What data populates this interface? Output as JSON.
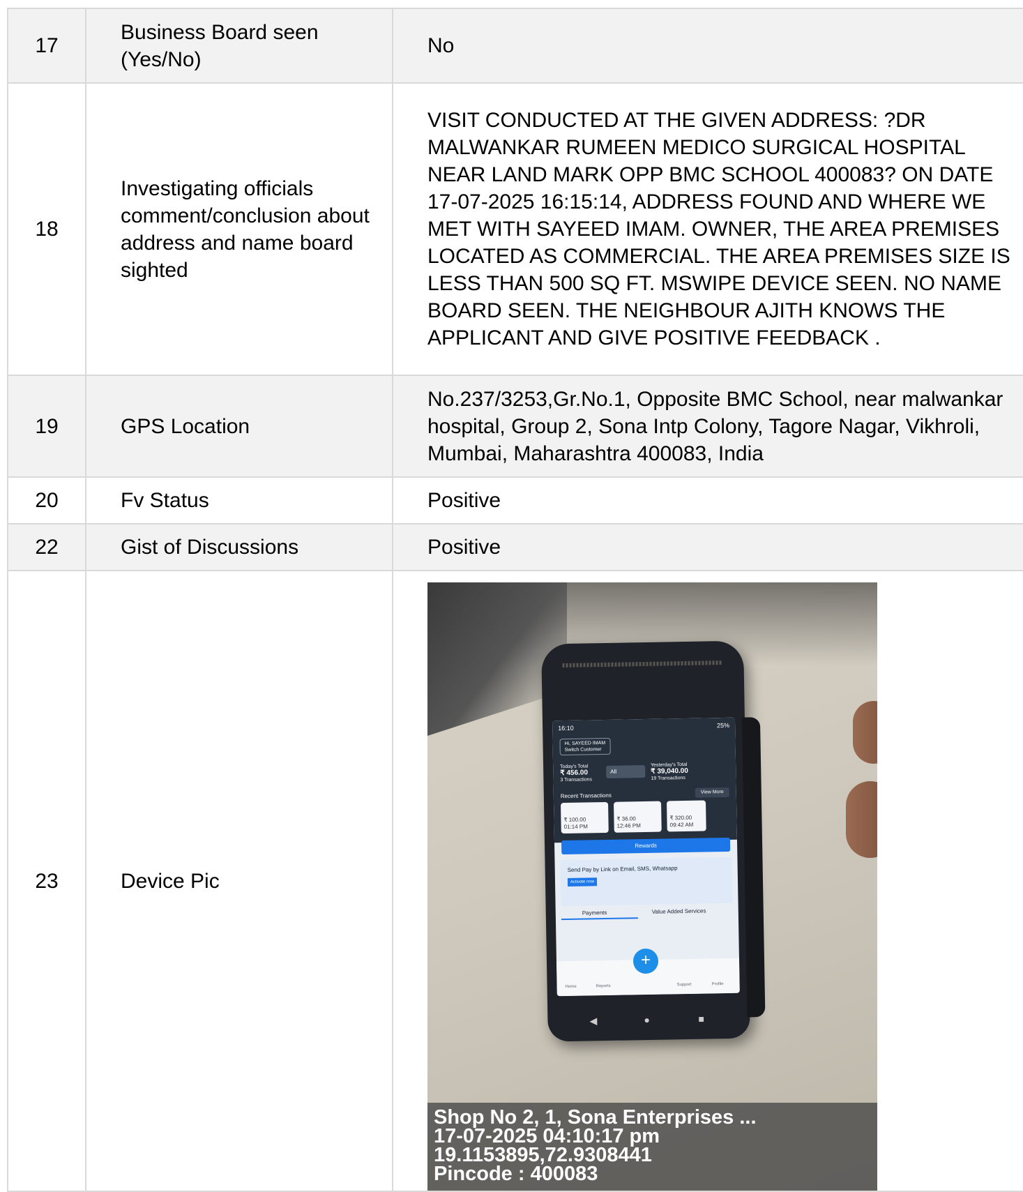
{
  "rows": [
    {
      "no": "17",
      "label": "Business Board seen (Yes/No)",
      "value": "No"
    },
    {
      "no": "18",
      "label": "Investigating officials comment/conclusion about address and name board sighted",
      "value": "VISIT CONDUCTED AT THE GIVEN ADDRESS: ?DR MALWANKAR RUMEEN MEDICO SURGICAL HOSPITAL NEAR LAND MARK OPP BMC SCHOOL 400083? ON DATE 17-07-2025 16:15:14, ADDRESS FOUND AND WHERE WE MET WITH SAYEED IMAM. OWNER, THE AREA PREMISES LOCATED AS COMMERCIAL. THE AREA PREMISES SIZE IS LESS THAN 500 SQ FT. MSWIPE DEVICE SEEN. NO NAME BOARD SEEN. THE NEIGHBOUR AJITH KNOWS THE APPLICANT AND GIVE POSITIVE FEEDBACK ."
    },
    {
      "no": "19",
      "label": "GPS Location",
      "value": "No.237/3253,Gr.No.1, Opposite BMC School, near malwankar hospital, Group 2, Sona Intp Colony, Tagore Nagar, Vikhroli, Mumbai, Maharashtra 400083, India"
    },
    {
      "no": "20",
      "label": "Fv Status",
      "value": "Positive"
    },
    {
      "no": "22",
      "label": "Gist of Discussions",
      "value": "Positive"
    },
    {
      "no": "23",
      "label": "Device Pic",
      "value": ""
    }
  ],
  "photo": {
    "caption": [
      "Shop No 2, 1, Sona Enterprises ...",
      "17-07-2025 04:10:17 pm",
      "19.1153895,72.9308441",
      "Pincode : 400083"
    ],
    "screen": {
      "status_time": "16:10",
      "battery": "25%",
      "greeting": "Hi, SAYEED IMAM",
      "switch": "Switch Customer",
      "today_label": "Today's Total",
      "today_amount": "₹ 456.00",
      "today_count": "3 Transactions",
      "filter": "All",
      "yesterday_label": "Yesterday's Total",
      "yesterday_amount": "₹ 39,040.00",
      "yesterday_count": "19 Transactions",
      "recent": "Recent Transactions",
      "view_more": "View More",
      "tx1": "₹ 100.00",
      "tx1_time": "01:14 PM",
      "tx2": "₹ 36.00",
      "tx2_time": "12:46 PM",
      "tx3": "₹ 320.00",
      "tx3_time": "09:42 AM",
      "rewards": "Rewards",
      "promo": "Send Pay by Link on Email, SMS, Whatsapp",
      "promo_btn": "Activate now",
      "tab1": "Payments",
      "tab2": "Value Added Services",
      "nav_home": "Home",
      "nav_reports": "Reports",
      "nav_support": "Support",
      "nav_profile": "Profile",
      "fab": "+"
    }
  }
}
